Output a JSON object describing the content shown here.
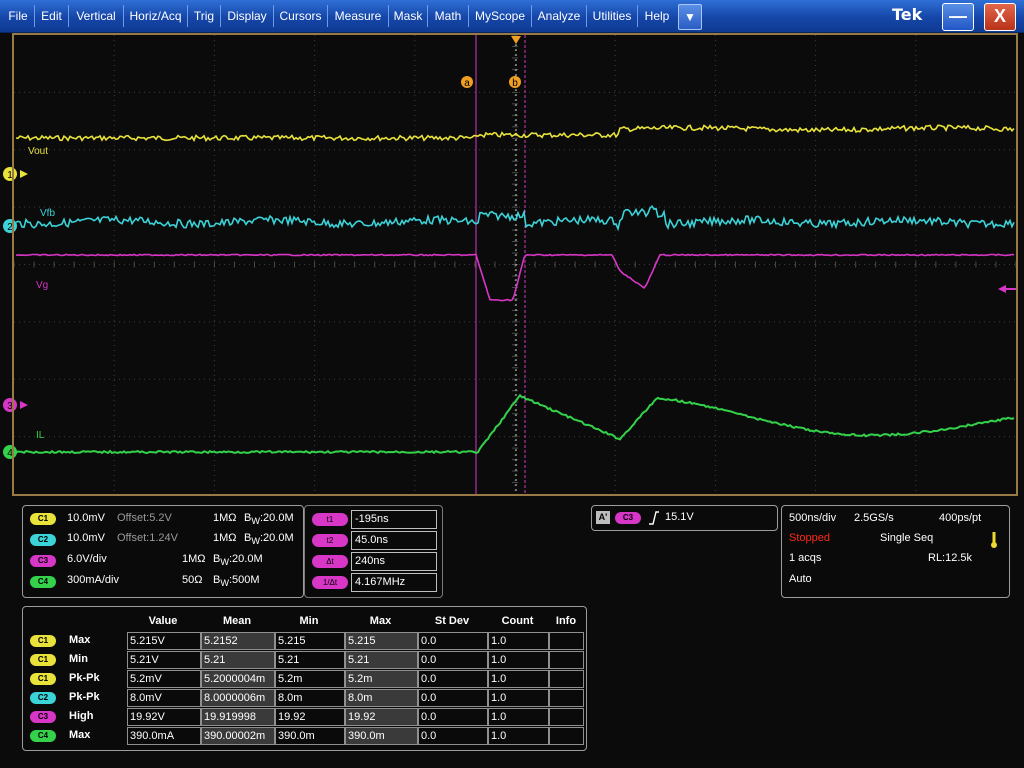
{
  "menu": {
    "items": [
      "File",
      "Edit",
      "Vertical",
      "Horiz/Acq",
      "Trig",
      "Display",
      "Cursors",
      "Measure",
      "Mask",
      "Math",
      "MyScope",
      "Analyze",
      "Utilities",
      "Help"
    ],
    "dropdown_icon": "▼",
    "logo": "Tek",
    "minimize_icon": "—",
    "close_icon": "X"
  },
  "waveforms": {
    "labels": {
      "vout": "Vout",
      "vfb": "Vfb",
      "vg": "Vg",
      "il": "IL"
    },
    "channel_markers": [
      "1",
      "2",
      "3",
      "4"
    ],
    "cursor_flags": {
      "a": "a",
      "b": "b"
    }
  },
  "channel_settings": [
    {
      "badge": "C1",
      "scale": "10.0mV",
      "offset": "Offset:5.2V",
      "impedance": "1MΩ",
      "bw_prefix": "B",
      "bw_sub": "W",
      "bw_value": ":20.0M"
    },
    {
      "badge": "C2",
      "scale": "10.0mV",
      "offset": "Offset:1.24V",
      "impedance": "1MΩ",
      "bw_prefix": "B",
      "bw_sub": "W",
      "bw_value": ":20.0M"
    },
    {
      "badge": "C3",
      "scale": "6.0V/div",
      "offset": "",
      "impedance": "1MΩ",
      "bw_prefix": "B",
      "bw_sub": "W",
      "bw_value": ":20.0M"
    },
    {
      "badge": "C4",
      "scale": "300mA/div",
      "offset": "",
      "impedance": "50Ω",
      "bw_prefix": "B",
      "bw_sub": "W",
      "bw_value": ":500M"
    }
  ],
  "cursors": [
    {
      "label": "t1",
      "value": "-195ns"
    },
    {
      "label": "t2",
      "value": "45.0ns"
    },
    {
      "label": "Δt",
      "value": "240ns"
    },
    {
      "label": "1/Δt",
      "value": "4.167MHz"
    }
  ],
  "trigger": {
    "source_a": "A'",
    "channel": "C3",
    "slope_icon": "rising-edge",
    "level": "15.1V"
  },
  "acquisition": {
    "time_div": "500ns/div",
    "sample_rate": "2.5GS/s",
    "resolution": "400ps/pt",
    "status": "Stopped",
    "mode": "Single Seq",
    "acqs": "1 acqs",
    "record_length": "RL:12.5k",
    "trigger_mode": "Auto"
  },
  "measurements": {
    "headers": [
      "Value",
      "Mean",
      "Min",
      "Max",
      "St Dev",
      "Count",
      "Info"
    ],
    "rows": [
      {
        "badge": "C1",
        "name": "Max",
        "value": "5.215V",
        "mean": "5.2152",
        "min": "5.215",
        "max": "5.215",
        "stdev": "0.0",
        "count": "1.0",
        "info": ""
      },
      {
        "badge": "C1",
        "name": "Min",
        "value": "5.21V",
        "mean": "5.21",
        "min": "5.21",
        "max": "5.21",
        "stdev": "0.0",
        "count": "1.0",
        "info": ""
      },
      {
        "badge": "C1",
        "name": "Pk-Pk",
        "value": "5.2mV",
        "mean": "5.2000004m",
        "min": "5.2m",
        "max": "5.2m",
        "stdev": "0.0",
        "count": "1.0",
        "info": ""
      },
      {
        "badge": "C2",
        "name": "Pk-Pk",
        "value": "8.0mV",
        "mean": "8.0000006m",
        "min": "8.0m",
        "max": "8.0m",
        "stdev": "0.0",
        "count": "1.0",
        "info": ""
      },
      {
        "badge": "C3",
        "name": "High",
        "value": "19.92V",
        "mean": "19.919998",
        "min": "19.92",
        "max": "19.92",
        "stdev": "0.0",
        "count": "1.0",
        "info": ""
      },
      {
        "badge": "C4",
        "name": "Max",
        "value": "390.0mA",
        "mean": "390.00002m",
        "min": "390.0m",
        "max": "390.0m",
        "stdev": "0.0",
        "count": "1.0",
        "info": ""
      }
    ]
  },
  "colors": {
    "ch1": "#e8e23a",
    "ch2": "#3bd3d8",
    "ch3": "#d836c6",
    "ch4": "#33d24a",
    "cursor": "#f0a020",
    "menubar": "#1f56bd"
  }
}
